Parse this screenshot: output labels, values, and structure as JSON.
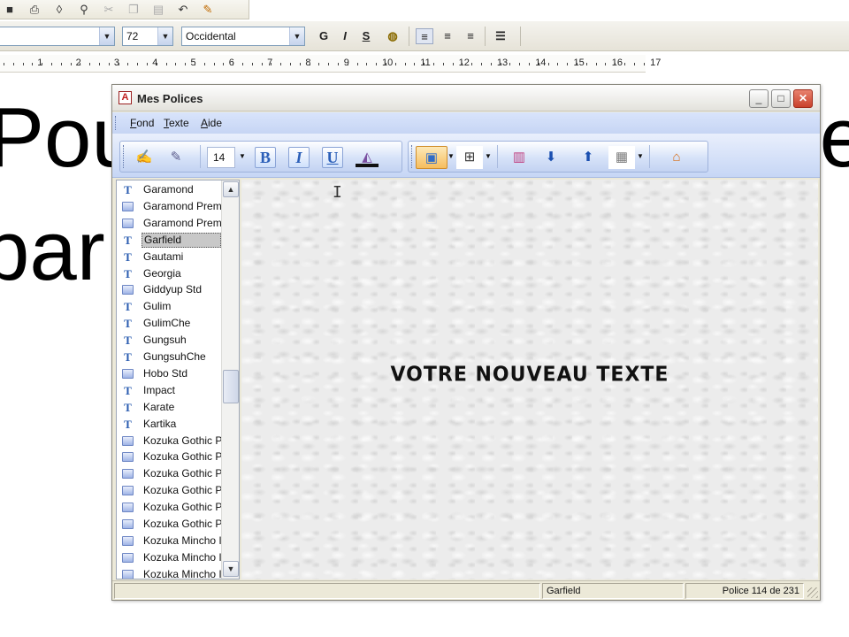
{
  "app": {
    "font_combo": "",
    "size_combo": "72",
    "script_combo": "Occidental",
    "format_bold": "G",
    "format_italic": "I",
    "format_underline": "S"
  },
  "ruler": {
    "numbers": [
      "1",
      "2",
      "3",
      "4",
      "5",
      "6",
      "7",
      "8",
      "9",
      "10",
      "11",
      "12",
      "13",
      "14",
      "15",
      "16",
      "17"
    ]
  },
  "document": {
    "line1": "Pou",
    "line1_end": "te",
    "line2": "par"
  },
  "window": {
    "title": "Mes Polices",
    "minimize": "_",
    "maximize": "□",
    "close": "✕"
  },
  "menu": [
    "Fond",
    "Texte",
    "Aide"
  ],
  "toolbar": {
    "font_size": "14",
    "bold": "B",
    "italic": "I",
    "underline": "U"
  },
  "fonts": [
    {
      "name": "Garamond",
      "type": "tt"
    },
    {
      "name": "Garamond Prem",
      "type": "ot"
    },
    {
      "name": "Garamond Prem",
      "type": "ot"
    },
    {
      "name": "Garfield",
      "type": "tt",
      "selected": true
    },
    {
      "name": "Gautami",
      "type": "tt"
    },
    {
      "name": "Georgia",
      "type": "tt"
    },
    {
      "name": "Giddyup Std",
      "type": "ot"
    },
    {
      "name": "Gulim",
      "type": "tt"
    },
    {
      "name": "GulimChe",
      "type": "tt"
    },
    {
      "name": "Gungsuh",
      "type": "tt"
    },
    {
      "name": "GungsuhChe",
      "type": "tt"
    },
    {
      "name": "Hobo Std",
      "type": "ot"
    },
    {
      "name": "Impact",
      "type": "tt"
    },
    {
      "name": "Karate",
      "type": "tt"
    },
    {
      "name": "Kartika",
      "type": "tt"
    },
    {
      "name": "Kozuka Gothic P",
      "type": "ot"
    },
    {
      "name": "Kozuka Gothic P",
      "type": "ot"
    },
    {
      "name": "Kozuka Gothic P",
      "type": "ot"
    },
    {
      "name": "Kozuka Gothic P",
      "type": "ot"
    },
    {
      "name": "Kozuka Gothic P",
      "type": "ot"
    },
    {
      "name": "Kozuka Gothic P",
      "type": "ot"
    },
    {
      "name": "Kozuka Mincho I",
      "type": "ot"
    },
    {
      "name": "Kozuka Mincho I",
      "type": "ot"
    },
    {
      "name": "Kozuka Mincho I",
      "type": "ot"
    }
  ],
  "preview": {
    "text": "VOTRE NOUVEAU TEXTE"
  },
  "status": {
    "font_name": "Garfield",
    "position": "Police 114 de 231"
  }
}
